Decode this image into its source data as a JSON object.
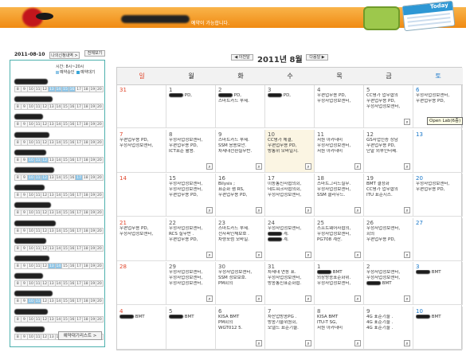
{
  "header": {
    "notice_suffix": "예약이 가능합니다.",
    "deco_label": "Today"
  },
  "sidebar": {
    "date": "2011-08-10",
    "today_button": "나의신청내역 >",
    "prev_button": "전체보기",
    "hours_label": "시간: 8시~20시",
    "legend_booked": "예약승인",
    "legend_pending": "예약대기",
    "slot_hours": [
      "8",
      "9",
      "10",
      "11",
      "12",
      "13",
      "14",
      "15",
      "16",
      "17",
      "18",
      "19",
      "20"
    ],
    "rooms": [
      {
        "booked": [
          5,
          6,
          7,
          8
        ]
      },
      {
        "booked": []
      },
      {
        "booked": []
      },
      {
        "booked": []
      },
      {
        "booked": [
          2,
          3,
          4
        ]
      },
      {
        "booked": [
          2,
          3,
          4,
          9
        ]
      },
      {
        "booked": []
      },
      {
        "booked": []
      },
      {
        "booked": []
      },
      {
        "booked": []
      },
      {
        "booked": [
          5,
          6
        ]
      },
      {
        "booked": []
      },
      {
        "booked": [
          2,
          3
        ]
      },
      {
        "booked": []
      },
      {
        "booked": []
      }
    ],
    "reserve_button": "예약대기리스트 >"
  },
  "nav": {
    "prev": "◀ 이전달",
    "title": "2011년 8월",
    "next": "다음달 ▶"
  },
  "calendar": {
    "weekdays": [
      "일",
      "월",
      "화",
      "수",
      "목",
      "금",
      "토"
    ],
    "weeks": [
      [
        {
          "d": "31",
          "ev": []
        },
        {
          "d": "1",
          "ev": [
            "▒ PD,"
          ]
        },
        {
          "d": "2",
          "ev": [
            "▒ PD,",
            "스마트카드 부제."
          ]
        },
        {
          "d": "3",
          "ev": [
            "▒ PD,"
          ]
        },
        {
          "d": "4",
          "ev": [
            "우편업무용 PD,",
            "우정사업정보센터,"
          ]
        },
        {
          "d": "5",
          "ev": [
            "CC평가 업무협의",
            "우편업무용 PD,",
            "우정사업정보센터,"
          ]
        },
        {
          "d": "6",
          "ev": [
            "우정사업정보센터,",
            "우편업무용 PD,"
          ]
        }
      ],
      [
        {
          "d": "7",
          "ev": [
            "우편업무용 PD,",
            "우정사업정보센터,"
          ]
        },
        {
          "d": "8",
          "ev": [
            "우정사업정보센터,",
            "우편업무용 PD,",
            "ICT표준 활용."
          ]
        },
        {
          "d": "9",
          "ev": [
            "스마트카드 부제.",
            "SSM 응용보안.",
            "차세대전환실무반."
          ]
        },
        {
          "d": "10",
          "ev": [
            "CC평가 체결,",
            "우편업무용 PD,",
            "방통위 모바일시."
          ]
        },
        {
          "d": "11",
          "ev": [
            "서원 아카데미",
            "우정사업정보센터,",
            "서원 아카데미"
          ]
        },
        {
          "d": "12",
          "ev": [
            "GS사업인증 상담",
            "우편업무용 PD,",
            "단말 외부인터페."
          ]
        },
        {
          "d": "13",
          "ev": []
        }
      ],
      [
        {
          "d": "14",
          "ev": []
        },
        {
          "d": "15",
          "ev": [
            "우정사업정보센터,",
            "우정사업정보센터,",
            "우편업무용 PD,"
          ]
        },
        {
          "d": "16",
          "ev": [
            "Bilysis ;",
            "표준화 샘 RS,",
            "우편업무용 PD,"
          ]
        },
        {
          "d": "17",
          "ev": [
            "이동통신사협의회,",
            "네트워크사협의회,",
            "우정사업정보센터,"
          ]
        },
        {
          "d": "18",
          "ev": [
            "스마트그리드실무.",
            "우정사업정보센터,",
            "SSM 클라우드."
          ]
        },
        {
          "d": "19",
          "ev": [
            "BMT 결정화",
            "CC평가 업무협의",
            "ITU 표준시스."
          ]
        },
        {
          "d": "20",
          "ev": [
            "우정사업정보센터,",
            "우편업무용 PD,"
          ]
        }
      ],
      [
        {
          "d": "21",
          "ev": [
            "우편업무용 PD,",
            "우정사업정보센터,"
          ]
        },
        {
          "d": "22",
          "ev": [
            "우정사업정보센터,",
            "RCS 실무반 .",
            "우편업무용 PD,"
          ]
        },
        {
          "d": "23",
          "ev": [
            "스마트카드 부제.",
            "전자파인체보호 .",
            "차량포럼 모바일."
          ]
        },
        {
          "d": "24",
          "ev": [
            "우정사업정보센터,",
            "▒ 계.",
            "▒ 계."
          ]
        },
        {
          "d": "25",
          "ev": [
            "스프트웨어사협의,",
            "우정사업정보센터,",
            "PG708 계산."
          ]
        },
        {
          "d": "26",
          "ev": [
            "우정사업정보센터,",
            "회의",
            "우편업무용 PD,"
          ]
        },
        {
          "d": "27",
          "ev": []
        }
      ],
      [
        {
          "d": "28",
          "ev": []
        },
        {
          "d": "29",
          "ev": [
            "우정사업정보센터,",
            "우정사업정보센터,",
            "우정사업정보센터,"
          ]
        },
        {
          "d": "30",
          "ev": [
            "우정사업정보센터,",
            "SSM 정보보호.",
            "PM회의"
          ]
        },
        {
          "d": "31",
          "ev": [
            "차세대 연동 표.",
            "우정사업정보센터,",
            "방송통신표준화협."
          ]
        },
        {
          "d": "1",
          "ev": [
            "▒ BMT",
            "외장방송표준화위.",
            "우정사업정보센터,"
          ]
        },
        {
          "d": "2",
          "ev": [
            "우정사업정보센터,",
            "우정사업정보센터,",
            "▒ BMT"
          ]
        },
        {
          "d": "3",
          "ev": [
            "▒ BMT"
          ]
        }
      ],
      [
        {
          "d": "4",
          "ev": [
            "▒ BMT"
          ]
        },
        {
          "d": "5",
          "ev": [
            "▒ BMT"
          ]
        },
        {
          "d": "6",
          "ev": [
            "KISA BMT",
            "PM회의",
            "WGT012 5."
          ]
        },
        {
          "d": "7",
          "ev": [
            "차산업방송PG .",
            "방송기술위원회,",
            "모델드 표준기술."
          ]
        },
        {
          "d": "8",
          "ev": [
            "KISA BMT",
            "ITU-T SG,",
            "서원 아카데미"
          ]
        },
        {
          "d": "9",
          "ev": [
            "4G 표준기술 .",
            "4G 표준기술 .",
            "4G 표준기술 ."
          ]
        },
        {
          "d": "10",
          "ev": [
            "▒ BMT"
          ]
        }
      ]
    ],
    "tooltip": "Open Lab(6층)"
  }
}
